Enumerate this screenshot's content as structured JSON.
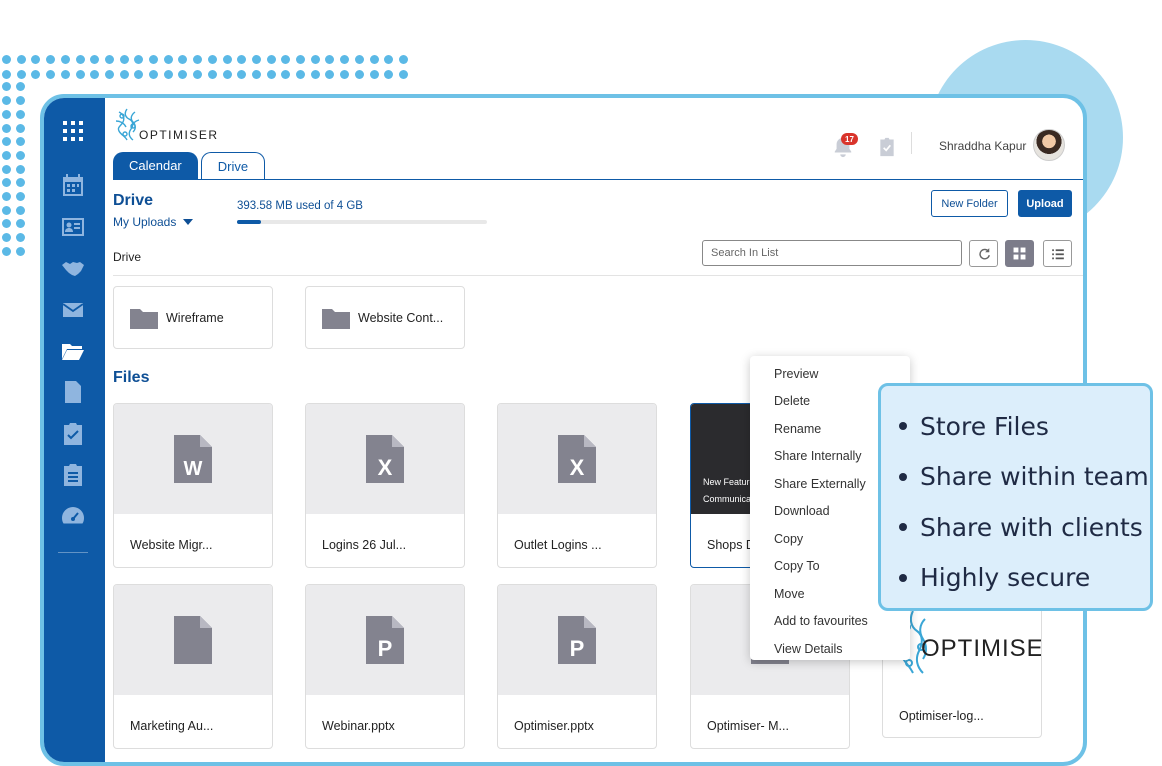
{
  "app": {
    "logo_text": "OPTIMISER",
    "tabs": [
      {
        "label": "Calendar",
        "active": true
      },
      {
        "label": "Drive",
        "active": false
      }
    ]
  },
  "header": {
    "notification_count": "17",
    "user_name": "Shraddha Kapur"
  },
  "drive": {
    "title": "Drive",
    "view_selector": "My Uploads",
    "storage_text": "393.58 MB used of 4 GB",
    "storage_fraction": 0.096,
    "new_folder_label": "New Folder",
    "upload_label": "Upload",
    "breadcrumb": "Drive",
    "search_placeholder": "Search In List"
  },
  "folders": [
    {
      "name": "Wireframe"
    },
    {
      "name": "Website Cont..."
    }
  ],
  "files_title": "Files",
  "files": [
    {
      "name": "Website Migr...",
      "type": "W"
    },
    {
      "name": "Logins 26 Jul...",
      "type": "X"
    },
    {
      "name": "Outlet Logins ...",
      "type": "X"
    },
    {
      "name": "Shops D",
      "type": "image",
      "thumb_line1": "New Feature R",
      "thumb_line2": "Communicatio"
    },
    {
      "name": "Marketing Au...",
      "type": "file"
    },
    {
      "name": "Webinar.pptx",
      "type": "P"
    },
    {
      "name": "Optimiser.pptx",
      "type": "P"
    },
    {
      "name": "Optimiser- M...",
      "type": "file"
    },
    {
      "name": "Optimiser-log...",
      "type": "logo",
      "thumb_text": "OPTIMISER"
    }
  ],
  "context_menu": [
    "Preview",
    "Delete",
    "Rename",
    "Share Internally",
    "Share Externally",
    "Download",
    "Copy",
    "Copy To",
    "Move",
    "Add to favourites",
    "View Details"
  ],
  "features": [
    "Store Files",
    "Share within team",
    "Share with clients",
    "Highly secure"
  ],
  "colors": {
    "brand": "#0e5aa7",
    "accent": "#6ec1e6",
    "feature_bg": "#dceefb"
  },
  "sidebar_icons": [
    "apps-grid-icon",
    "calendar-icon",
    "contact-card-icon",
    "handshake-icon",
    "mail-icon",
    "folder-open-icon",
    "document-icon",
    "task-check-icon",
    "clipboard-icon",
    "dashboard-gauge-icon"
  ]
}
